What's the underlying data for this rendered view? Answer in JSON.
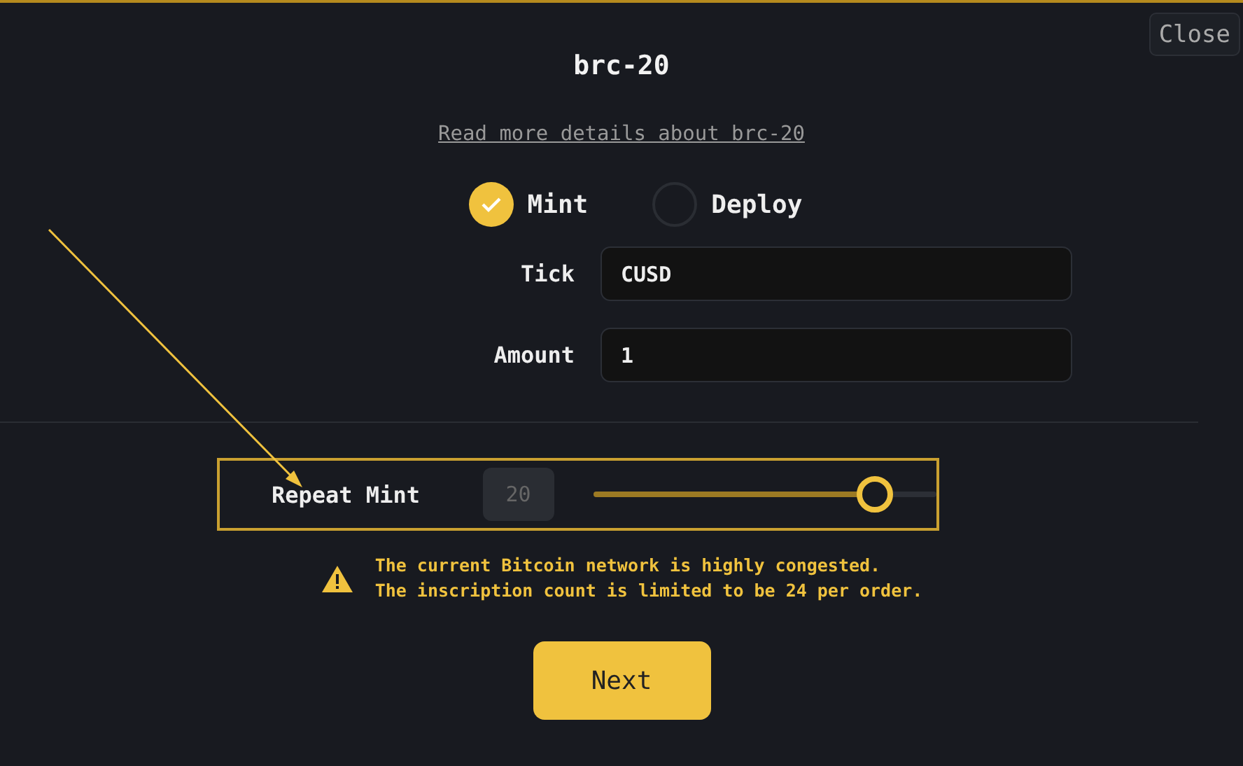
{
  "close_button": "Close",
  "title": "brc-20",
  "details_link": "Read more details about brc-20",
  "operations": [
    {
      "label": "Mint",
      "selected": true
    },
    {
      "label": "Deploy",
      "selected": false
    }
  ],
  "fields": [
    {
      "label": "Tick",
      "value": "CUSD"
    },
    {
      "label": "Amount",
      "value": "1"
    }
  ],
  "repeat_mint": {
    "label": "Repeat Mint",
    "value": "20",
    "disabled": true,
    "level": 0.82
  },
  "warning": [
    "The current Bitcoin network is highly congested.",
    "The inscription count is limited to be 24 per order."
  ],
  "next_button": "Next"
}
